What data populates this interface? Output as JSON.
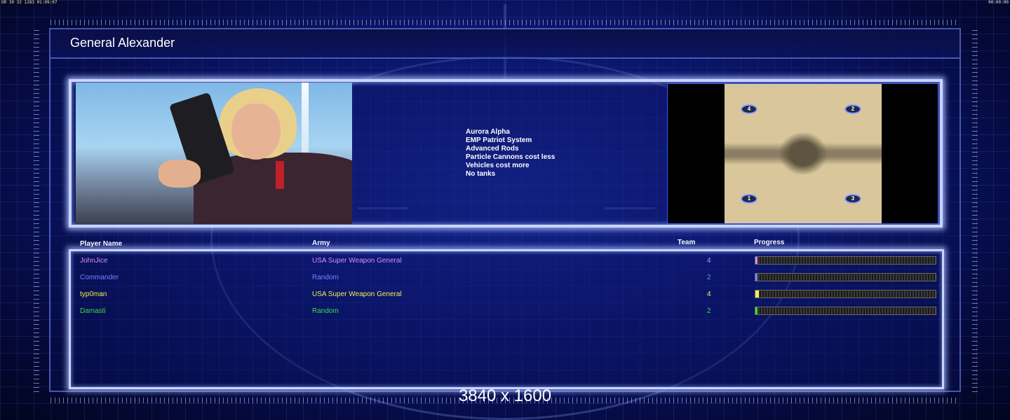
{
  "top_stats": {
    "left": "OR 30 32 1283 01:09:07",
    "right": "00:00:00"
  },
  "general": {
    "name": "General Alexander"
  },
  "perks": [
    "Aurora Alpha",
    "EMP Patriot System",
    "Advanced Rods",
    "Particle Cannons cost less",
    "Vehicles cost more",
    "No tanks"
  ],
  "map": {
    "spawns": [
      "4",
      "2",
      "1",
      "3"
    ]
  },
  "table": {
    "headers": {
      "player": "Player Name",
      "army": "Army",
      "team": "Team",
      "progress": "Progress"
    },
    "rows": [
      {
        "name": "JohnJice",
        "army": "USA Super Weapon General",
        "team": "4",
        "color": "#d48cff",
        "progress": 0.01
      },
      {
        "name": "Commander",
        "army": "Random",
        "team": "2",
        "color": "#6f86ff",
        "progress": 0.0
      },
      {
        "name": "typ0man",
        "army": "USA Super Weapon General",
        "team": "4",
        "color": "#f0f050",
        "progress": 0.02
      },
      {
        "name": "Damasti",
        "army": "Random",
        "team": "2",
        "color": "#3ddc3d",
        "progress": 0.0
      }
    ]
  },
  "resolution": "3840 x 1600"
}
